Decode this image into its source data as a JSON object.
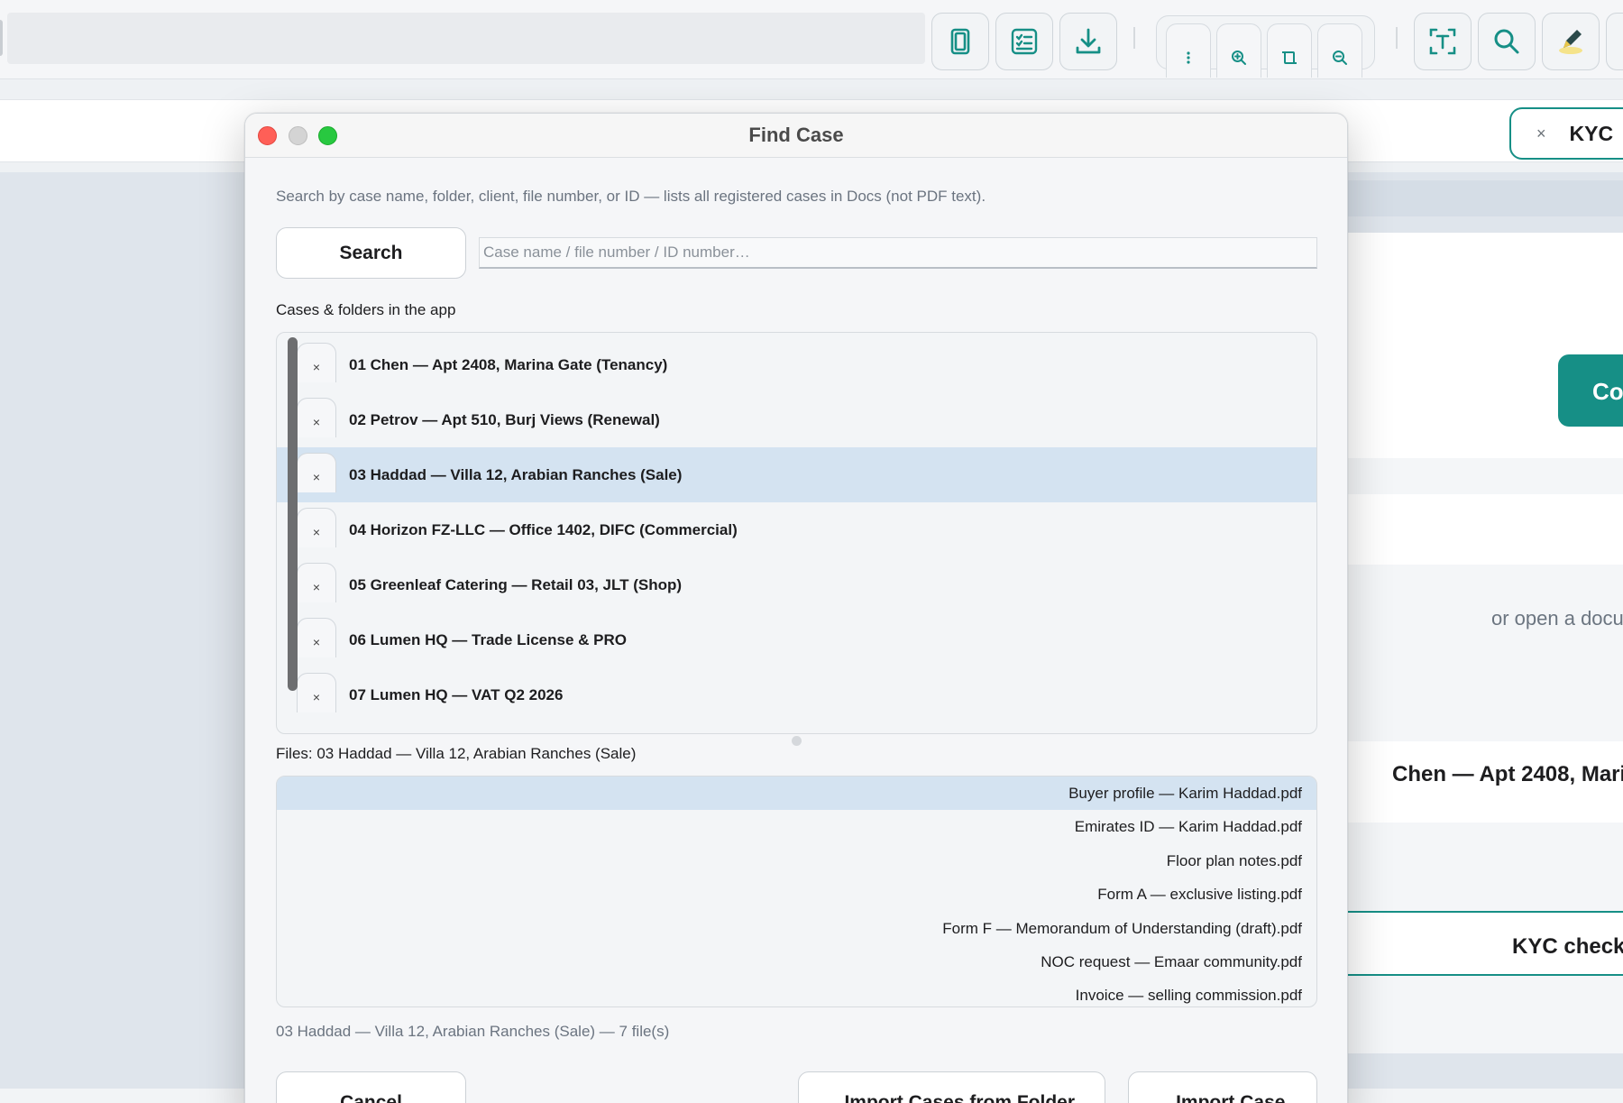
{
  "toolbar": {
    "icons": [
      "book-icon",
      "checklist-icon",
      "download-icon",
      "more-vertical-icon",
      "zoom-in-icon",
      "fit-width-icon",
      "zoom-out-icon",
      "text-recognition-icon",
      "search-icon",
      "highlighter-icon"
    ],
    "accent": "#168f86"
  },
  "background": {
    "kyc_tab": "KYC",
    "kyc_tab_close": "×",
    "cta_partial": "Co",
    "open_doc_partial": "or open a docu",
    "case_title_partial": "Chen — Apt 2408, Mari",
    "kyc_check_partial": "KYC check"
  },
  "dialog": {
    "title": "Find Case",
    "hint": "Search by case name, folder, client, file number, or ID — lists all registered cases in Docs (not PDF text).",
    "search_button": "Search",
    "search_placeholder": "Case name / file number / ID number…",
    "search_value": "",
    "cases_label": "Cases & folders in the app",
    "cases": [
      {
        "label": "01 Chen — Apt 2408, Marina Gate (Tenancy)",
        "close": "×"
      },
      {
        "label": "02 Petrov — Apt 510, Burj Views (Renewal)",
        "close": "×"
      },
      {
        "label": "03 Haddad — Villa 12, Arabian Ranches (Sale)",
        "close": "×"
      },
      {
        "label": "04 Horizon FZ-LLC — Office 1402, DIFC (Commercial)",
        "close": "×"
      },
      {
        "label": "05 Greenleaf Catering — Retail 03, JLT (Shop)",
        "close": "×"
      },
      {
        "label": "06 Lumen HQ — Trade License & PRO",
        "close": "×"
      },
      {
        "label": "07 Lumen HQ — VAT Q2 2026",
        "close": "×"
      }
    ],
    "selected_case_index": 2,
    "files_label": "Files: 03 Haddad — Villa 12, Arabian Ranches (Sale)",
    "files": [
      "Buyer profile — Karim Haddad.pdf",
      "Emirates ID — Karim Haddad.pdf",
      "Floor plan notes.pdf",
      "Form A — exclusive listing.pdf",
      "Form F — Memorandum of Understanding (draft).pdf",
      "NOC request — Emaar community.pdf",
      "Invoice — selling commission.pdf"
    ],
    "selected_file_index": 0,
    "status": "03 Haddad — Villa 12, Arabian Ranches (Sale) — 7 file(s)",
    "cancel_button": "Cancel",
    "import_folder_button": "...Import Cases from Folder",
    "import_case_button": "...Import Case"
  }
}
